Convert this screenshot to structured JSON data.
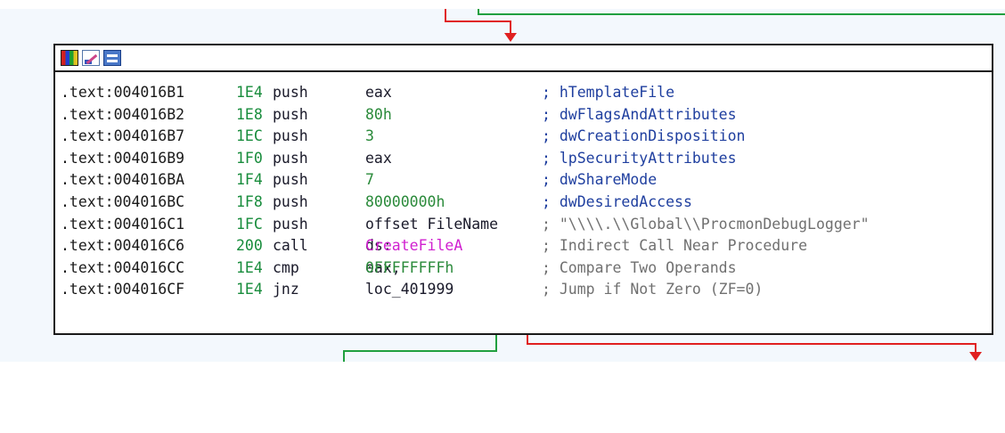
{
  "toolbar": {
    "icons": [
      "palette-icon",
      "edit-icon",
      "graph-icon"
    ]
  },
  "colors": {
    "false_edge": "#e02020",
    "true_edge": "#21a040",
    "comment_blue": "#1f3f9f",
    "comment_gray": "#707070",
    "stack_green": "#188c3c",
    "api_magenta": "#d020d0"
  },
  "lines": [
    {
      "addr": ".text:004016B1",
      "sp": "1E4",
      "mnem": "push",
      "op": "eax",
      "comment": "; hTemplateFile"
    },
    {
      "addr": ".text:004016B2",
      "sp": "1E8",
      "mnem": "push",
      "op": "80h",
      "comment": "; dwFlagsAndAttributes"
    },
    {
      "addr": ".text:004016B7",
      "sp": "1EC",
      "mnem": "push",
      "op": "3",
      "comment": "; dwCreationDisposition"
    },
    {
      "addr": ".text:004016B9",
      "sp": "1F0",
      "mnem": "push",
      "op": "eax",
      "comment": "; lpSecurityAttributes"
    },
    {
      "addr": ".text:004016BA",
      "sp": "1F4",
      "mnem": "push",
      "op": "7",
      "comment": "; dwShareMode"
    },
    {
      "addr": ".text:004016BC",
      "sp": "1F8",
      "mnem": "push",
      "op": "80000000h",
      "comment": "; dwDesiredAccess"
    },
    {
      "addr": ".text:004016C1",
      "sp": "1FC",
      "mnem": "push",
      "op": "offset FileName",
      "comment": "; \"\\\\\\\\.\\\\Global\\\\ProcmonDebugLogger\""
    },
    {
      "addr": ".text:004016C6",
      "sp": "200",
      "mnem": "call",
      "op_seg": "ds:",
      "op_fn": "CreateFileA",
      "comment": "; Indirect Call Near Procedure"
    },
    {
      "addr": ".text:004016CC",
      "sp": "1E4",
      "mnem": "cmp",
      "op_reg": "eax, ",
      "op_num": "0FFFFFFFFh",
      "comment": "; Compare Two Operands"
    },
    {
      "addr": ".text:004016CF",
      "sp": "1E4",
      "mnem": "jnz",
      "op": "loc_401999",
      "comment": "; Jump if Not Zero (ZF=0)"
    }
  ]
}
